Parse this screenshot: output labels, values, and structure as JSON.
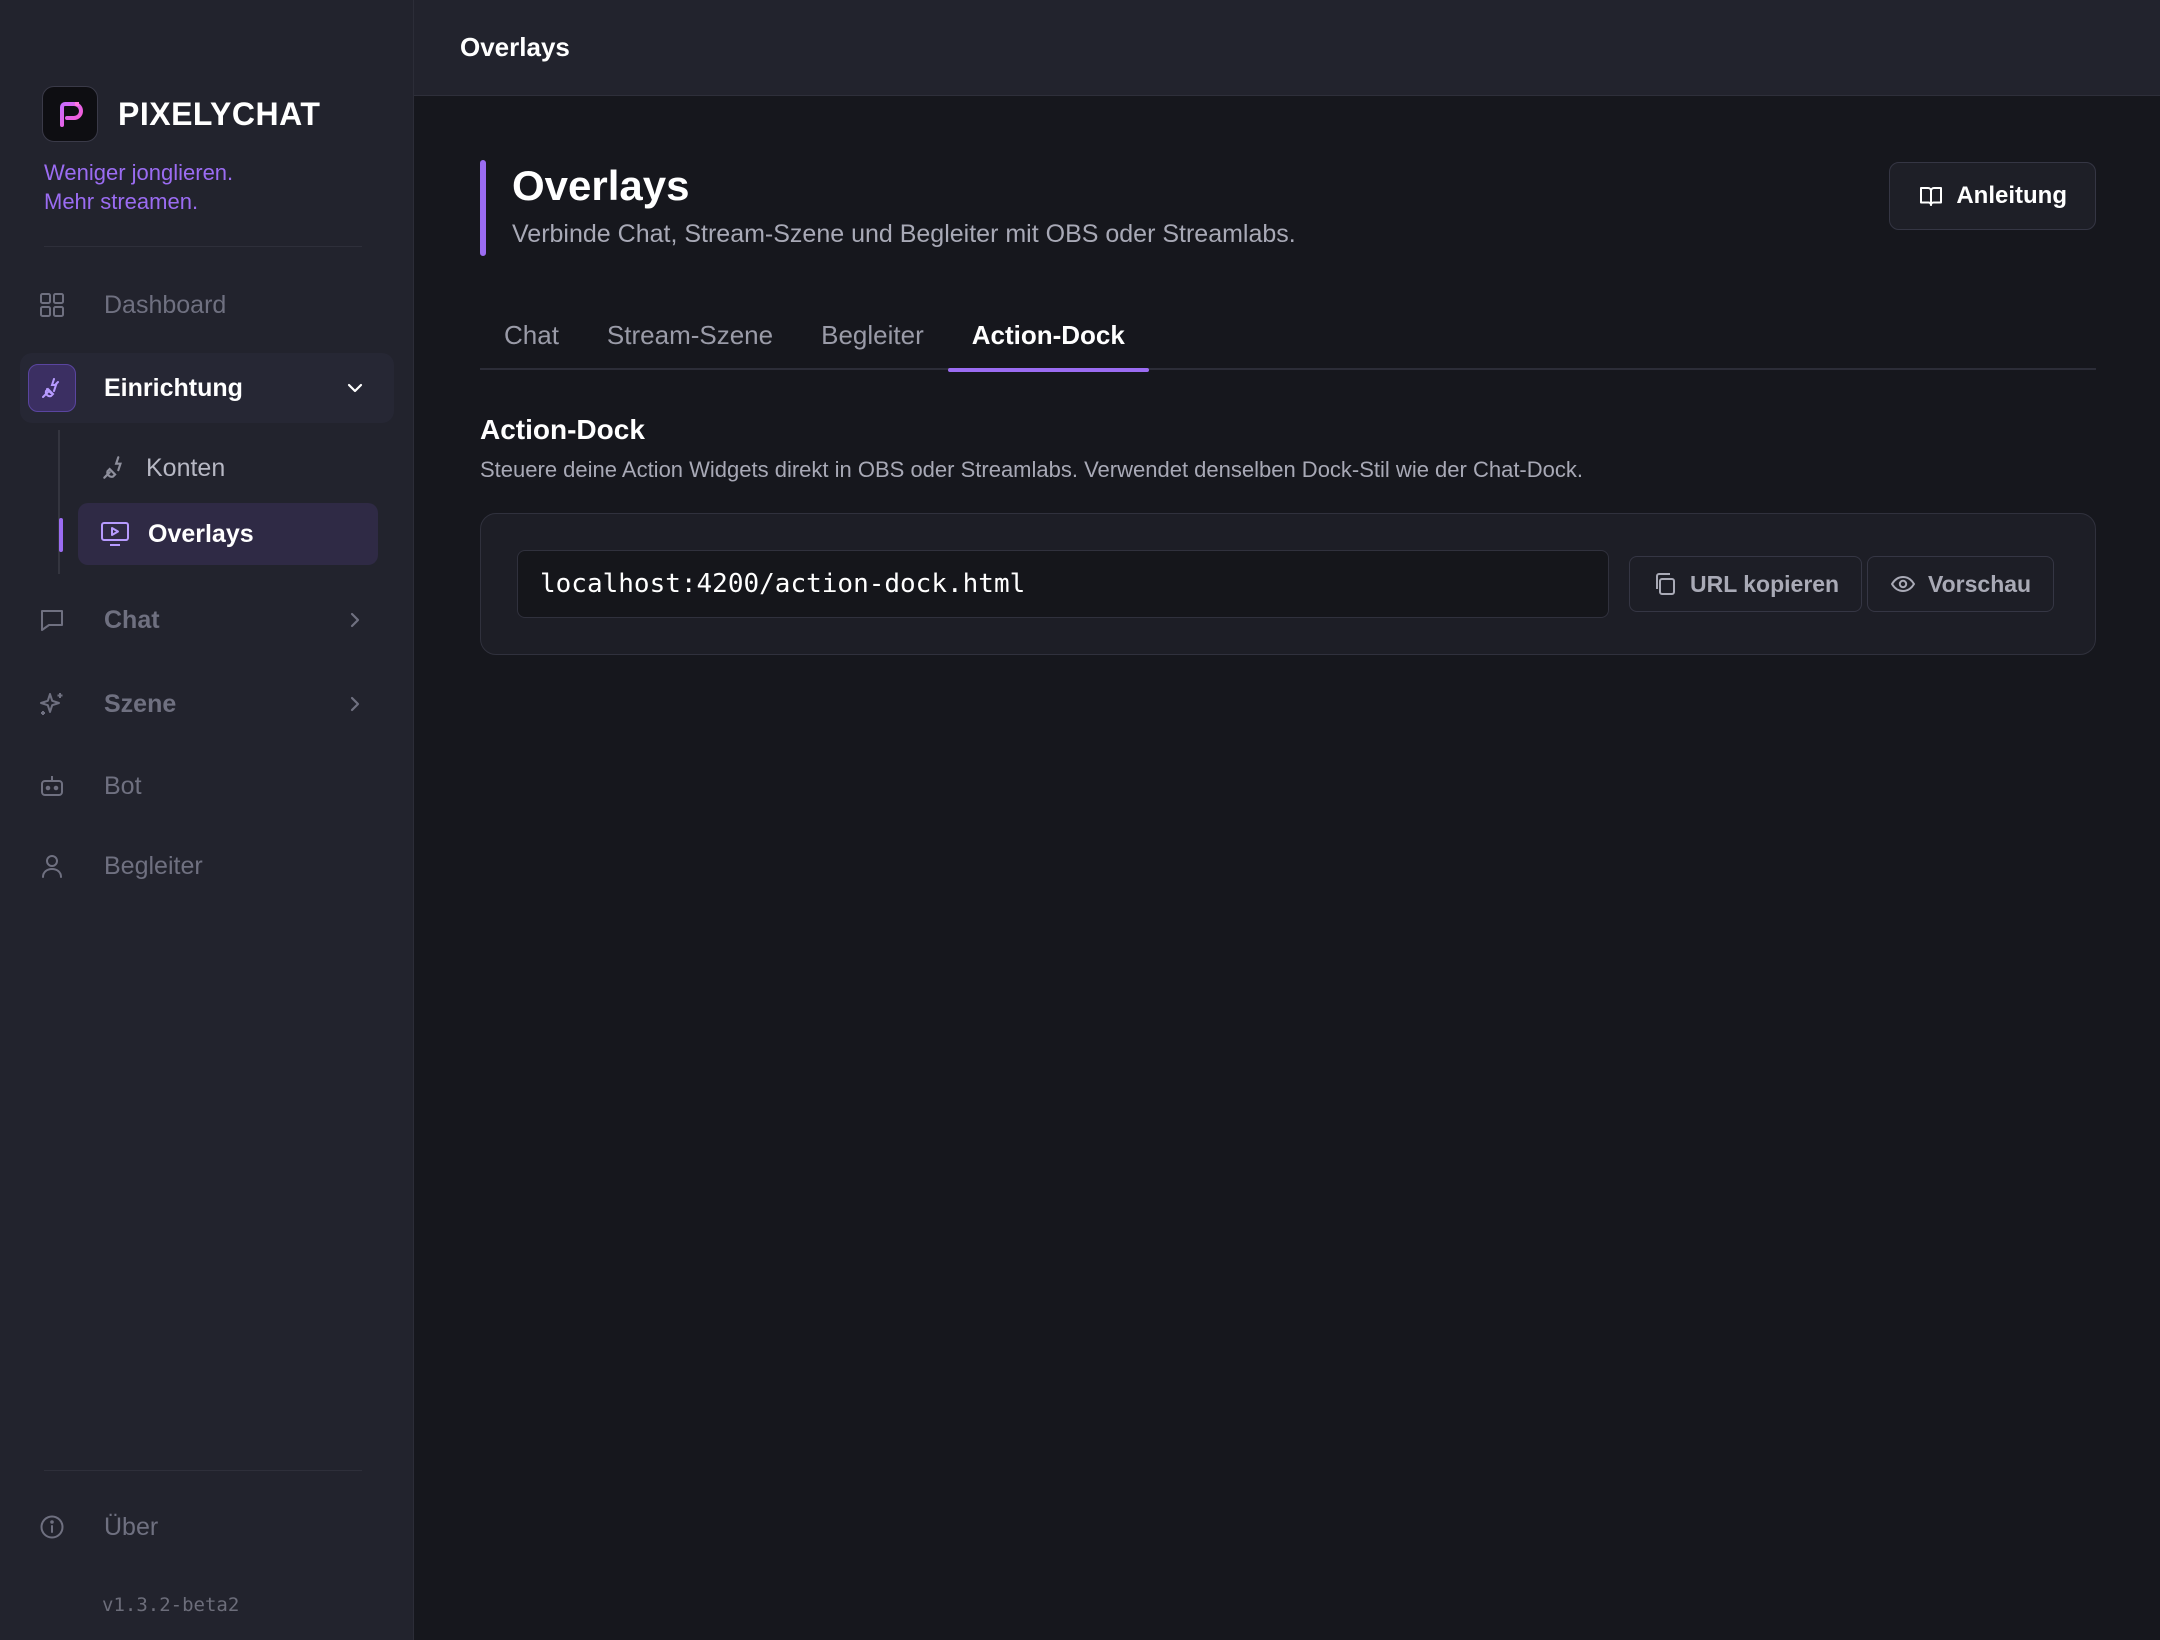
{
  "brand": {
    "name": "PIXELYCHAT",
    "tagline_line1": "Weniger jonglieren.",
    "tagline_line2": "Mehr streamen.",
    "accent_color": "#9b6cf2"
  },
  "sidebar": {
    "items": [
      {
        "label": "Dashboard",
        "icon": "grid-icon"
      },
      {
        "label": "Einrichtung",
        "icon": "plug-icon",
        "expanded": true
      },
      {
        "label": "Chat",
        "icon": "chat-bubble-icon"
      },
      {
        "label": "Szene",
        "icon": "sparkle-icon"
      },
      {
        "label": "Bot",
        "icon": "robot-icon"
      },
      {
        "label": "Begleiter",
        "icon": "user-icon"
      }
    ],
    "sub_items": [
      {
        "label": "Konten",
        "icon": "plug-icon"
      },
      {
        "label": "Overlays",
        "icon": "monitor-play-icon",
        "active": true
      }
    ],
    "about_label": "Über",
    "version": "v1.3.2-beta2"
  },
  "topbar": {
    "title": "Overlays"
  },
  "page": {
    "title": "Overlays",
    "subtitle": "Verbinde Chat, Stream-Szene und Begleiter mit OBS oder Streamlabs.",
    "guide_button": "Anleitung"
  },
  "tabs": [
    {
      "label": "Chat",
      "active": false
    },
    {
      "label": "Stream-Szene",
      "active": false
    },
    {
      "label": "Begleiter",
      "active": false
    },
    {
      "label": "Action-Dock",
      "active": true
    }
  ],
  "section": {
    "title": "Action-Dock",
    "description": "Steuere deine Action Widgets direkt in OBS oder Streamlabs. Verwendet denselben Dock-Stil wie der Chat-Dock.",
    "url": "localhost:4200/action-dock.html",
    "copy_button": "URL kopieren",
    "preview_button": "Vorschau"
  }
}
